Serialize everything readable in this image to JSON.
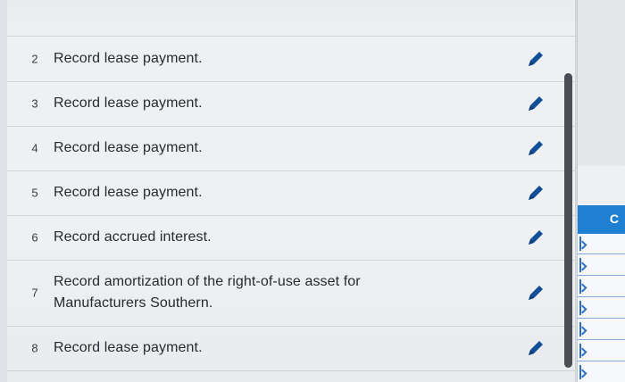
{
  "tasks": [
    {
      "number": "2",
      "label": "Record lease payment."
    },
    {
      "number": "3",
      "label": "Record lease payment."
    },
    {
      "number": "4",
      "label": "Record lease payment."
    },
    {
      "number": "5",
      "label": "Record lease payment."
    },
    {
      "number": "6",
      "label": "Record accrued interest."
    },
    {
      "number": "7",
      "label": "Record amortization of the right-of-use asset for Manufacturers Southern."
    },
    {
      "number": "8",
      "label": "Record lease payment."
    }
  ],
  "right_panel": {
    "header_text": "C",
    "accent_color": "#1f7fd0"
  },
  "icons": {
    "edit": "pencil-icon"
  }
}
